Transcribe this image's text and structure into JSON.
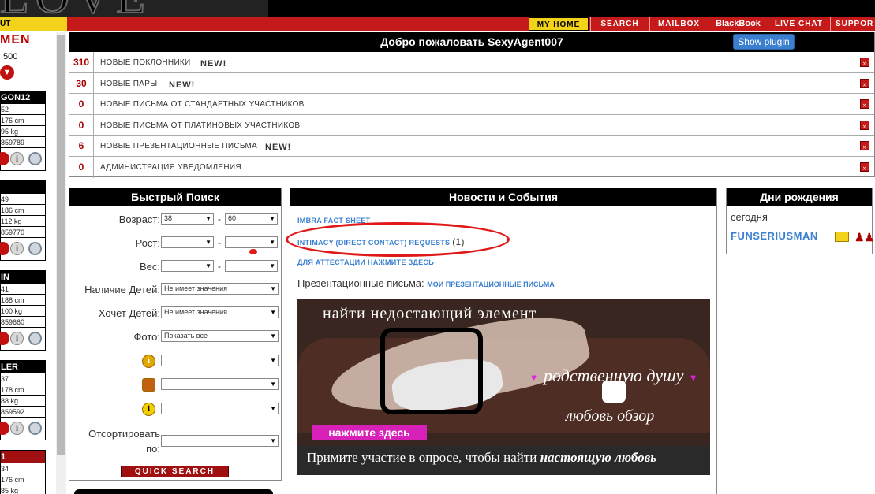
{
  "logo_text": "LOVE",
  "nav": {
    "out_label": "UT",
    "items": [
      "MY HOME",
      "SEARCH",
      "MAILBOX",
      "BlackBook",
      "LIVE CHAT",
      "SUPPOR"
    ]
  },
  "sidebar": {
    "title": "MEN",
    "count": "500",
    "members": [
      {
        "name": "GON12",
        "age": "52",
        "height": "176 cm",
        "weight": "95 kg",
        "id": "859789"
      },
      {
        "name": "",
        "age": "49",
        "height": "186 cm",
        "weight": "112 kg",
        "id": "859770"
      },
      {
        "name": "IN",
        "age": "41",
        "height": "188 cm",
        "weight": "100 kg",
        "id": "859660"
      },
      {
        "name": "LER",
        "age": "37",
        "height": "178 cm",
        "weight": "88 kg",
        "id": "859592"
      },
      {
        "name": "1",
        "age": "34",
        "height": "176 cm",
        "weight": "85 kg",
        "id": ""
      }
    ]
  },
  "welcome": {
    "title": "Добро пожаловать SexyAgent007",
    "plugin_button": "Show plugin",
    "rows": [
      {
        "count": "310",
        "label": "НОВЫЕ ПОКЛОННИКИ",
        "new": "NEW!"
      },
      {
        "count": "30",
        "label": "НОВЫЕ ПАРЫ",
        "new": "NEW!"
      },
      {
        "count": "0",
        "label": "НОВЫЕ ПИСЬМА ОТ СТАНДАРТНЫХ УЧАСТНИКОВ",
        "new": ""
      },
      {
        "count": "0",
        "label": "НОВЫЕ ПИСЬМА ОТ ПЛАТИНОВЫХ УЧАСТНИКОВ",
        "new": ""
      },
      {
        "count": "6",
        "label": "НОВЫЕ ПРЕЗЕНТАЦИОННЫЕ ПИСЬМА",
        "new": "NEW!"
      },
      {
        "count": "0",
        "label": "АДМИНИСТРАЦИЯ УВЕДОМЛЕНИЯ",
        "new": ""
      }
    ]
  },
  "quick_search": {
    "title": "Быстрый Поиск",
    "age_label": "Возраст:",
    "age_from": "38",
    "age_to": "60",
    "height_label": "Рост:",
    "weight_label": "Вес:",
    "children_label": "Наличие Детей:",
    "children_value": "Не имеет значения",
    "want_children_label": "Хочет Детей:",
    "want_children_value": "Не имеет значения",
    "photo_label": "Фото:",
    "photo_value": "Показать все",
    "sort_label_1": "Отсортировать",
    "sort_label_2": "по:",
    "button": "QUICK SEARCH"
  },
  "news": {
    "title": "Новости и События",
    "link1": "IMBRA FACT SHEET",
    "link2": "INTIMACY (DIRECT CONTACT) REQUESTS",
    "link2_count": "(1)",
    "link3": "ДЛЯ АТТЕСТАЦИИ НАЖМИТЕ ЗДЕСЬ",
    "presentation_text": "Презентационные письма:",
    "presentation_link": "МОИ ПРЕЗЕНТАЦИОННЫЕ ПИСЬМА",
    "banner": {
      "line1": "найти недостающий элемент",
      "line2": "родственную душу",
      "line3": "любовь обзор",
      "button": "нажмите здесь",
      "bottom_regular": "Примите участие в опросе, чтобы найти ",
      "bottom_bold": "настоящую любовь"
    }
  },
  "birthdays": {
    "title": "Дни рождения",
    "today_label": "сегодня",
    "name": "FUNSERIUSMAN"
  }
}
